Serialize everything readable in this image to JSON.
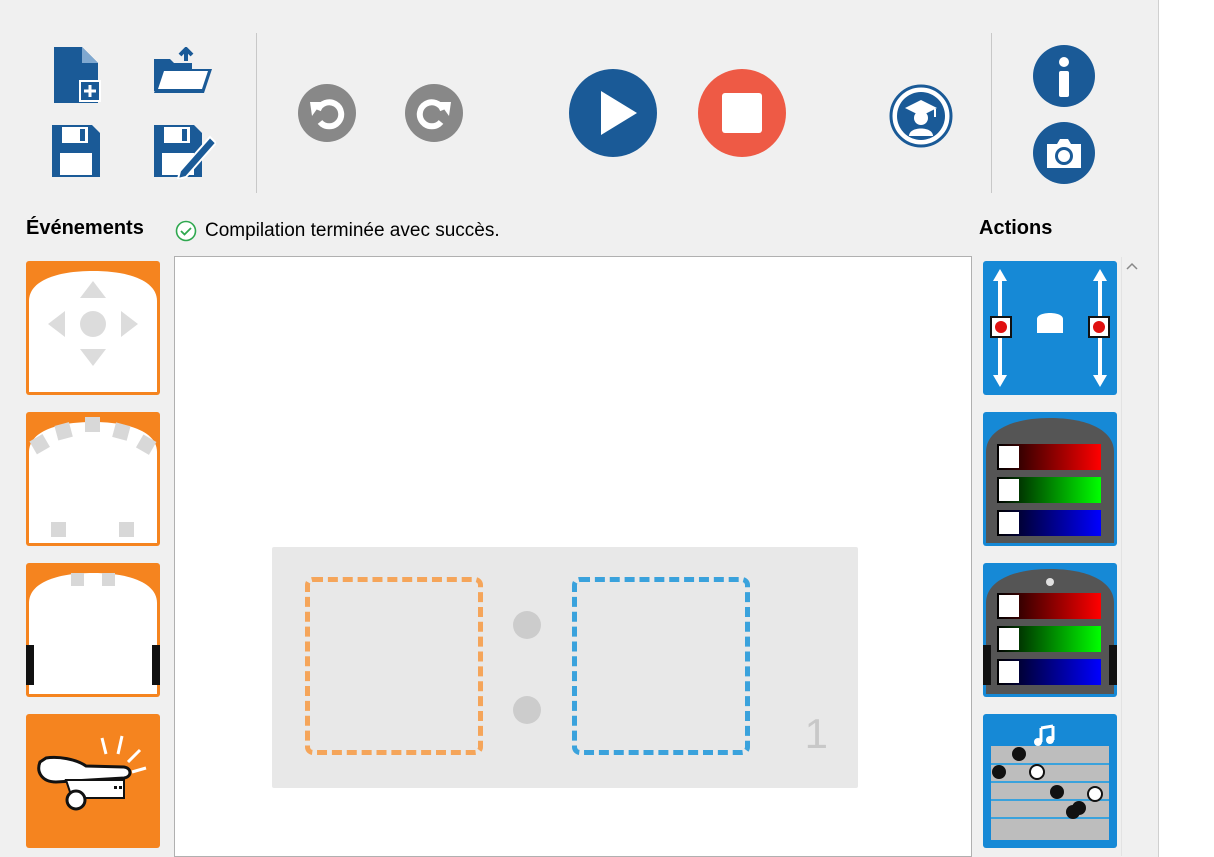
{
  "toolbar": {
    "buttons": [
      {
        "id": "new",
        "icon": "new-file-icon",
        "color": "#1a5a97"
      },
      {
        "id": "open",
        "icon": "open-folder-icon",
        "color": "#1a5a97"
      },
      {
        "id": "save",
        "icon": "save-icon",
        "color": "#1a5a97"
      },
      {
        "id": "save_as",
        "icon": "save-as-icon",
        "color": "#1a5a97"
      },
      {
        "id": "undo",
        "icon": "undo-icon",
        "color": "#888888"
      },
      {
        "id": "redo",
        "icon": "redo-icon",
        "color": "#888888"
      },
      {
        "id": "run",
        "icon": "play-icon",
        "color": "#1a5a97"
      },
      {
        "id": "stop",
        "icon": "stop-icon",
        "color": "#ee5a45"
      },
      {
        "id": "teacher",
        "icon": "teacher-icon",
        "color": "#1a5a97"
      },
      {
        "id": "info",
        "icon": "info-icon",
        "color": "#1a5a97"
      },
      {
        "id": "screenshot",
        "icon": "camera-icon",
        "color": "#1a5a97"
      }
    ]
  },
  "events_header": "Événements",
  "status": {
    "text": "Compilation terminée avec succès.",
    "icon": "check-circle-icon",
    "color": "#2fa84f"
  },
  "actions_header": "Actions",
  "events_palette": [
    {
      "icon": "buttons-event-icon"
    },
    {
      "icon": "front-proximity-event-icon"
    },
    {
      "icon": "ground-sensor-event-icon"
    },
    {
      "icon": "tap-event-icon"
    }
  ],
  "actions_palette": [
    {
      "icon": "motors-action-icon"
    },
    {
      "icon": "top-color-action-icon"
    },
    {
      "icon": "bottom-color-action-icon"
    },
    {
      "icon": "music-action-icon"
    }
  ],
  "rule": {
    "number": "1",
    "event_slot_color": "#f5a55a",
    "action_slot_color": "#3aa2dc"
  },
  "colors": {
    "brand_blue": "#1a5a97",
    "event_orange": "#f5841f",
    "action_blue": "#1689d6"
  }
}
